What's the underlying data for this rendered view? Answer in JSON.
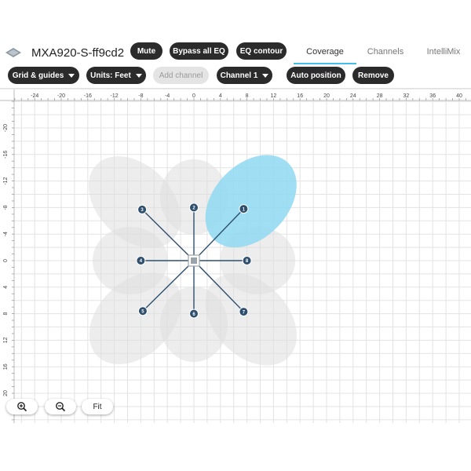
{
  "header": {
    "device_icon": "device-diamond-icon",
    "device_name": "MXA920-S-ff9cd2",
    "buttons": {
      "mute": "Mute",
      "bypass_eq": "Bypass all EQ",
      "eq_contour": "EQ contour"
    },
    "tabs": {
      "coverage": "Coverage",
      "channels": "Channels",
      "intellimix": "IntelliMix"
    },
    "active_tab": "Coverage"
  },
  "toolbar": {
    "grid_guides": "Grid & guides",
    "units": "Units: Feet",
    "add_channel": "Add channel",
    "channel": "Channel 1",
    "auto_position": "Auto position",
    "remove": "Remove"
  },
  "grid": {
    "x_ticks": [
      "-24",
      "-20",
      "-16",
      "-12",
      "-8",
      "-4",
      "0",
      "4",
      "8",
      "12",
      "16",
      "20",
      "24",
      "28",
      "32",
      "36",
      "40"
    ],
    "y_ticks": [
      "-20",
      "-16",
      "-12",
      "-8",
      "-4",
      "0",
      "4",
      "8",
      "12",
      "16",
      "20"
    ]
  },
  "channels": [
    {
      "label": "1",
      "x_ft": 7.5,
      "y_ft": -7.8,
      "selected": true
    },
    {
      "label": "2",
      "x_ft": 0.0,
      "y_ft": -8.0,
      "selected": false
    },
    {
      "label": "3",
      "x_ft": -7.8,
      "y_ft": -7.7,
      "selected": false
    },
    {
      "label": "4",
      "x_ft": -8.0,
      "y_ft": 0.0,
      "selected": false
    },
    {
      "label": "5",
      "x_ft": -7.7,
      "y_ft": 7.6,
      "selected": false
    },
    {
      "label": "6",
      "x_ft": 0.0,
      "y_ft": 8.0,
      "selected": false
    },
    {
      "label": "7",
      "x_ft": 7.5,
      "y_ft": 7.7,
      "selected": false
    },
    {
      "label": "8",
      "x_ft": 8.0,
      "y_ft": 0.0,
      "selected": false
    }
  ],
  "colors": {
    "selected_lobe": "#8fd8f2",
    "lobe": "#dedede",
    "node": "#2f4f6e",
    "grid": "#e3e3e3",
    "accent": "#46bde6"
  },
  "zoom": {
    "zoom_in_icon": "zoom-in-icon",
    "zoom_out_icon": "zoom-out-icon",
    "fit": "Fit"
  }
}
